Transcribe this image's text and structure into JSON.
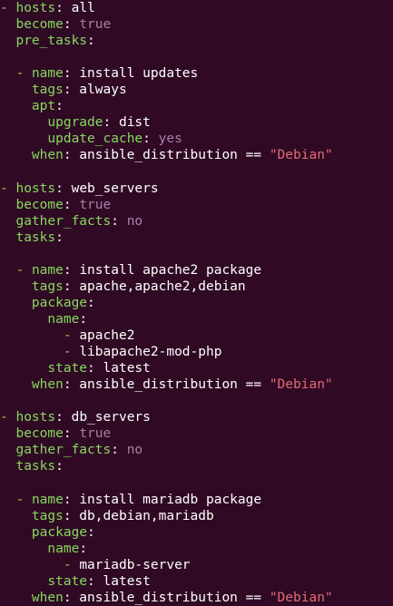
{
  "colors": {
    "background": "#300a24",
    "dash": "#d7af5f",
    "key": "#87d75f",
    "boolean": "#ad7fa8",
    "string": "#e06c75",
    "text": "#ffffff"
  },
  "lines": [
    {
      "indent": "",
      "tokens": [
        {
          "t": "dash",
          "v": "- "
        },
        {
          "t": "key",
          "v": "hosts"
        },
        {
          "t": "plain",
          "v": ": all"
        }
      ]
    },
    {
      "indent": "  ",
      "tokens": [
        {
          "t": "key",
          "v": "become"
        },
        {
          "t": "plain",
          "v": ": "
        },
        {
          "t": "bool",
          "v": "true"
        }
      ]
    },
    {
      "indent": "  ",
      "tokens": [
        {
          "t": "key",
          "v": "pre_tasks"
        },
        {
          "t": "plain",
          "v": ":"
        }
      ]
    },
    {
      "indent": "",
      "tokens": []
    },
    {
      "indent": "  ",
      "tokens": [
        {
          "t": "dash",
          "v": "- "
        },
        {
          "t": "key",
          "v": "name"
        },
        {
          "t": "plain",
          "v": ": install updates"
        }
      ]
    },
    {
      "indent": "    ",
      "tokens": [
        {
          "t": "key",
          "v": "tags"
        },
        {
          "t": "plain",
          "v": ": always"
        }
      ]
    },
    {
      "indent": "    ",
      "tokens": [
        {
          "t": "key",
          "v": "apt"
        },
        {
          "t": "plain",
          "v": ":"
        }
      ]
    },
    {
      "indent": "      ",
      "tokens": [
        {
          "t": "key",
          "v": "upgrade"
        },
        {
          "t": "plain",
          "v": ": dist"
        }
      ]
    },
    {
      "indent": "      ",
      "tokens": [
        {
          "t": "key",
          "v": "update_cache"
        },
        {
          "t": "plain",
          "v": ": "
        },
        {
          "t": "bool",
          "v": "yes"
        }
      ]
    },
    {
      "indent": "    ",
      "tokens": [
        {
          "t": "key",
          "v": "when"
        },
        {
          "t": "plain",
          "v": ": ansible_distribution == "
        },
        {
          "t": "str",
          "v": "\"Debian\""
        }
      ]
    },
    {
      "indent": "",
      "tokens": []
    },
    {
      "indent": "",
      "tokens": [
        {
          "t": "dash",
          "v": "- "
        },
        {
          "t": "key",
          "v": "hosts"
        },
        {
          "t": "plain",
          "v": ": web_servers"
        }
      ]
    },
    {
      "indent": "  ",
      "tokens": [
        {
          "t": "key",
          "v": "become"
        },
        {
          "t": "plain",
          "v": ": "
        },
        {
          "t": "bool",
          "v": "true"
        }
      ]
    },
    {
      "indent": "  ",
      "tokens": [
        {
          "t": "key",
          "v": "gather_facts"
        },
        {
          "t": "plain",
          "v": ": "
        },
        {
          "t": "bool",
          "v": "no"
        }
      ]
    },
    {
      "indent": "  ",
      "tokens": [
        {
          "t": "key",
          "v": "tasks"
        },
        {
          "t": "plain",
          "v": ":"
        }
      ]
    },
    {
      "indent": "",
      "tokens": []
    },
    {
      "indent": "  ",
      "tokens": [
        {
          "t": "dash",
          "v": "- "
        },
        {
          "t": "key",
          "v": "name"
        },
        {
          "t": "plain",
          "v": ": install apache2 package"
        }
      ]
    },
    {
      "indent": "    ",
      "tokens": [
        {
          "t": "key",
          "v": "tags"
        },
        {
          "t": "plain",
          "v": ": apache,apache2,debian"
        }
      ]
    },
    {
      "indent": "    ",
      "tokens": [
        {
          "t": "key",
          "v": "package"
        },
        {
          "t": "plain",
          "v": ":"
        }
      ]
    },
    {
      "indent": "      ",
      "tokens": [
        {
          "t": "key",
          "v": "name"
        },
        {
          "t": "plain",
          "v": ":"
        }
      ]
    },
    {
      "indent": "        ",
      "tokens": [
        {
          "t": "dash",
          "v": "- "
        },
        {
          "t": "plain",
          "v": "apache2"
        }
      ]
    },
    {
      "indent": "        ",
      "tokens": [
        {
          "t": "dash",
          "v": "- "
        },
        {
          "t": "plain",
          "v": "libapache2-mod-php"
        }
      ]
    },
    {
      "indent": "      ",
      "tokens": [
        {
          "t": "key",
          "v": "state"
        },
        {
          "t": "plain",
          "v": ": latest"
        }
      ]
    },
    {
      "indent": "    ",
      "tokens": [
        {
          "t": "key",
          "v": "when"
        },
        {
          "t": "plain",
          "v": ": ansible_distribution == "
        },
        {
          "t": "str",
          "v": "\"Debian\""
        }
      ]
    },
    {
      "indent": "",
      "tokens": []
    },
    {
      "indent": "",
      "tokens": [
        {
          "t": "dash",
          "v": "- "
        },
        {
          "t": "key",
          "v": "hosts"
        },
        {
          "t": "plain",
          "v": ": db_servers"
        }
      ]
    },
    {
      "indent": "  ",
      "tokens": [
        {
          "t": "key",
          "v": "become"
        },
        {
          "t": "plain",
          "v": ": "
        },
        {
          "t": "bool",
          "v": "true"
        }
      ]
    },
    {
      "indent": "  ",
      "tokens": [
        {
          "t": "key",
          "v": "gather_facts"
        },
        {
          "t": "plain",
          "v": ": "
        },
        {
          "t": "bool",
          "v": "no"
        }
      ]
    },
    {
      "indent": "  ",
      "tokens": [
        {
          "t": "key",
          "v": "tasks"
        },
        {
          "t": "plain",
          "v": ":"
        }
      ]
    },
    {
      "indent": "",
      "tokens": []
    },
    {
      "indent": "  ",
      "tokens": [
        {
          "t": "dash",
          "v": "- "
        },
        {
          "t": "key",
          "v": "name"
        },
        {
          "t": "plain",
          "v": ": install mariadb package"
        }
      ]
    },
    {
      "indent": "    ",
      "tokens": [
        {
          "t": "key",
          "v": "tags"
        },
        {
          "t": "plain",
          "v": ": db,debian,mariadb"
        }
      ]
    },
    {
      "indent": "    ",
      "tokens": [
        {
          "t": "key",
          "v": "package"
        },
        {
          "t": "plain",
          "v": ":"
        }
      ]
    },
    {
      "indent": "      ",
      "tokens": [
        {
          "t": "key",
          "v": "name"
        },
        {
          "t": "plain",
          "v": ":"
        }
      ]
    },
    {
      "indent": "        ",
      "tokens": [
        {
          "t": "dash",
          "v": "- "
        },
        {
          "t": "plain",
          "v": "mariadb-server"
        }
      ]
    },
    {
      "indent": "      ",
      "tokens": [
        {
          "t": "key",
          "v": "state"
        },
        {
          "t": "plain",
          "v": ": latest"
        }
      ]
    },
    {
      "indent": "    ",
      "tokens": [
        {
          "t": "key",
          "v": "when"
        },
        {
          "t": "plain",
          "v": ": ansible_distribution == "
        },
        {
          "t": "str",
          "v": "\"Debian\""
        }
      ]
    }
  ]
}
